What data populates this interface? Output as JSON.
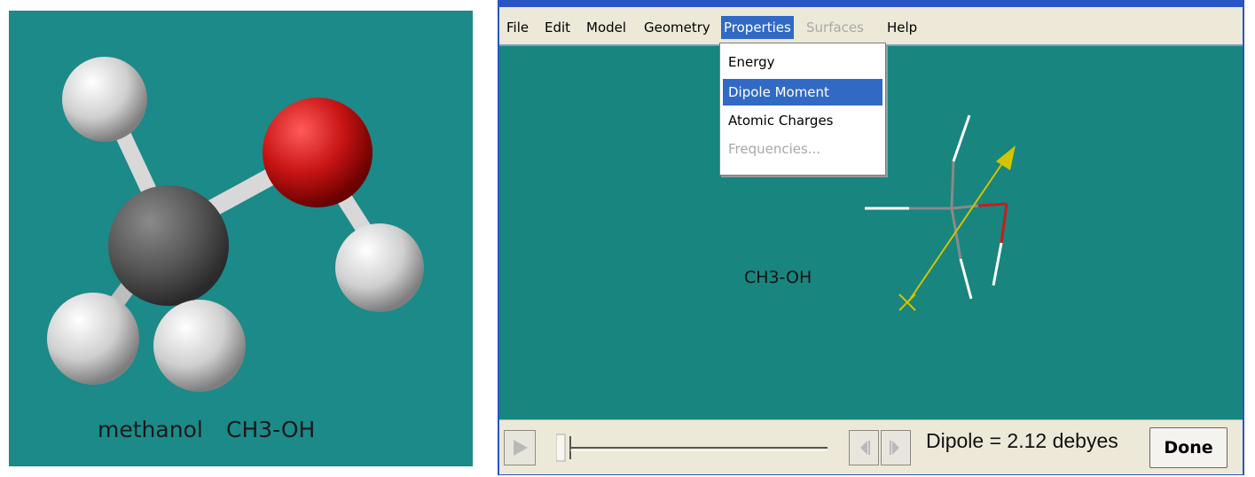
{
  "colors": {
    "teal_background": "#1b8a88",
    "viewport_background": "#18857f",
    "menu_highlight": "#316ac5",
    "dipole_vector": "#d4c400",
    "oxygen": "#cc1a1a",
    "carbon": "#555555",
    "hydrogen": "#e6e6e6"
  },
  "left_image": {
    "caption_name": "methanol",
    "caption_formula": "CH3-OH"
  },
  "menubar": {
    "items": [
      {
        "label": "File"
      },
      {
        "label": "Edit"
      },
      {
        "label": "Model"
      },
      {
        "label": "Geometry"
      },
      {
        "label": "Properties",
        "state": "active"
      },
      {
        "label": "Surfaces",
        "state": "disabled"
      },
      {
        "label": "Help"
      }
    ]
  },
  "properties_menu": {
    "items": [
      {
        "label": "Energy"
      },
      {
        "label": "Dipole Moment",
        "state": "selected"
      },
      {
        "label": "Atomic Charges"
      },
      {
        "label": "Frequencies...",
        "state": "disabled"
      }
    ]
  },
  "viewport": {
    "molecule_label": "CH3-OH"
  },
  "controlbar": {
    "icons": [
      "play-icon",
      "step-back-icon",
      "step-forward-icon"
    ],
    "dipole_readout": "Dipole = 2.12 debyes",
    "done_label": "Done"
  }
}
